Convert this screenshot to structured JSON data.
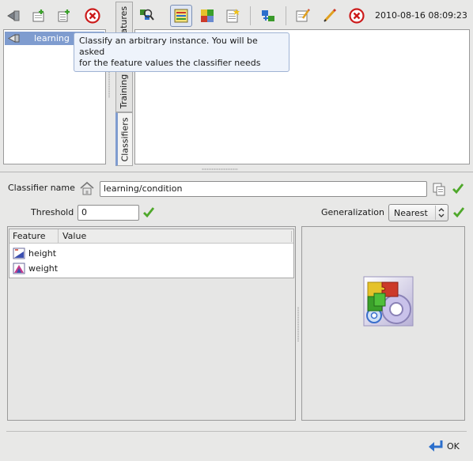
{
  "toolbar_left": {
    "icons": [
      "back-icon",
      "new-folder-icon",
      "new-item-icon",
      "close-icon"
    ]
  },
  "tree": {
    "selected_item": "learning"
  },
  "vertical_tabs": {
    "features": "Features",
    "training_sets": "Training sets",
    "classifiers": "Classifiers"
  },
  "toolbar_right": {
    "icons": [
      "inspect-icon",
      "classify-icon",
      "puzzle-icon",
      "notes-icon",
      "move-icon",
      "edit-icon",
      "pencil-icon",
      "delete-icon"
    ],
    "timestamp": "2010-08-16 08:09:23"
  },
  "tooltip": {
    "line1": "Classify an arbitrary instance. You will be asked",
    "line2": "for the feature values the classifier needs"
  },
  "form": {
    "classifier_name_label": "Classifier name",
    "classifier_name_value": "learning/condition",
    "threshold_label": "Threshold",
    "threshold_value": "0",
    "generalization_label": "Generalization",
    "generalization_value": "Nearest"
  },
  "feature_table": {
    "columns": [
      "Feature",
      "Value"
    ],
    "rows": [
      {
        "feature": "height",
        "value": ""
      },
      {
        "feature": "weight",
        "value": ""
      }
    ]
  },
  "footer": {
    "ok_label": "OK"
  },
  "colors": {
    "selection": "#7f9ccf",
    "check": "#4fa82b",
    "tooltip_bg": "#eef3fb"
  }
}
